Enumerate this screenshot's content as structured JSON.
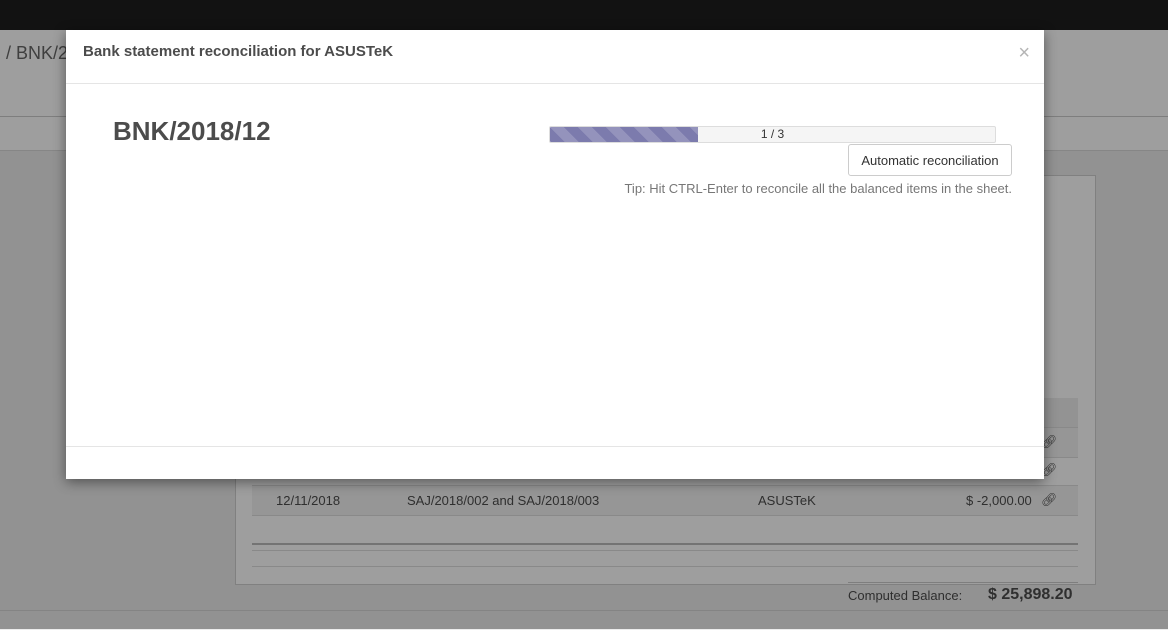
{
  "background": {
    "breadcrumb": "/  BNK/2",
    "rows": [
      {
        "date": "12/11/2018",
        "label": "SAJ/2018/002 and SAJ/2018/003",
        "partner": "ASUSTeK",
        "amount": "$ -2,000.00"
      }
    ],
    "computed_balance_label": "Computed Balance:",
    "computed_balance_value": "$ 25,898.20"
  },
  "modal": {
    "title": "Bank statement reconciliation for ASUSTeK",
    "close_glyph": "×",
    "statement_name": "BNK/2018/12",
    "progress": {
      "done": 1,
      "total": 3,
      "fraction": 0.3333,
      "label": "1 / 3"
    },
    "auto_button_label": "Automatic reconciliation",
    "tip": "Tip: Hit CTRL-Enter to reconcile all the balanced items in the sheet."
  },
  "colors": {
    "topbar": "#1e1e1e",
    "progress_fill": "#7c7bad"
  },
  "icons": {
    "row_action": "link-icon",
    "close": "close-icon"
  }
}
